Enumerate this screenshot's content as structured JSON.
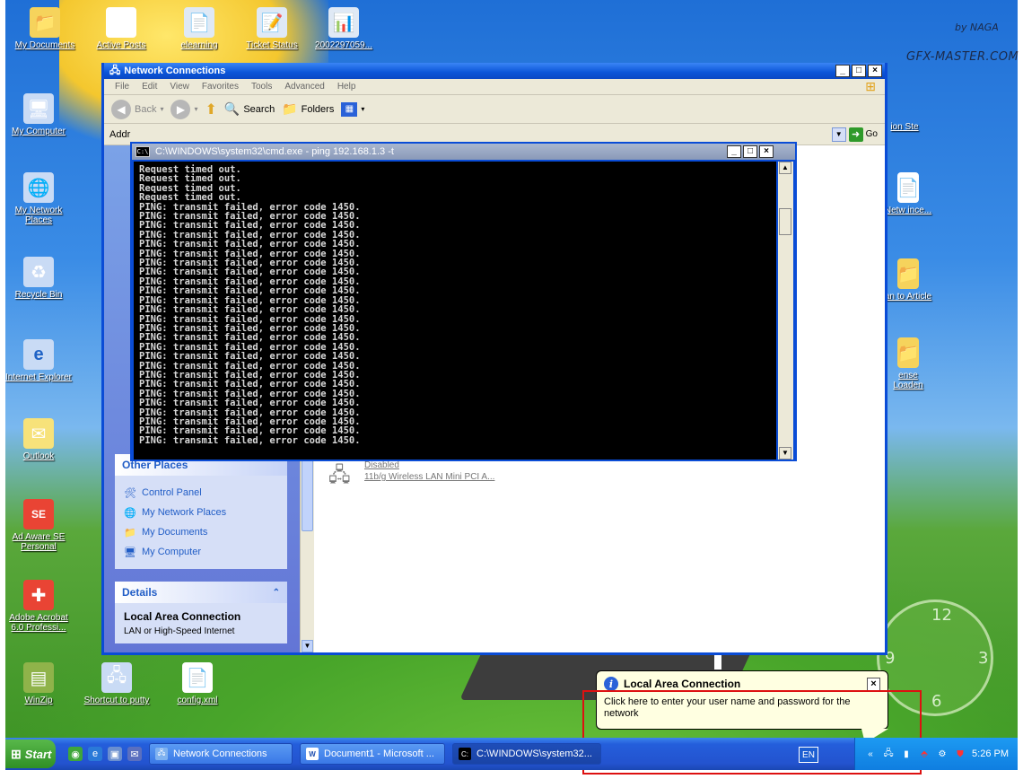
{
  "watermark": {
    "line1": "by NAGA",
    "line2": "GFX-MASTER.COM"
  },
  "desktop_icons": [
    {
      "label": "My Documents",
      "glyph": "📁",
      "color": "#f6d35c"
    },
    {
      "label": "Active Posts",
      "glyph": "🗺",
      "color": "#ffffff"
    },
    {
      "label": "elearning",
      "glyph": "📄",
      "color": "#dfe9f5"
    },
    {
      "label": "Ticket Status",
      "glyph": "📝",
      "color": "#dfe9f5"
    },
    {
      "label": "2002297059...",
      "glyph": "📊",
      "color": "#dfe9f5"
    },
    {
      "label": "My Computer",
      "glyph": "🖥",
      "color": "#c9dbf5"
    },
    {
      "label": "My Network Places",
      "glyph": "🌐",
      "color": "#c9dbf5"
    },
    {
      "label": "Recycle Bin",
      "glyph": "♻",
      "color": "#c9dbf5"
    },
    {
      "label": "Internet Explorer",
      "glyph": "e",
      "color": "#c9dbf5"
    },
    {
      "label": "Outlook",
      "glyph": "✉",
      "color": "#f7e27a"
    },
    {
      "label": "Ad Aware SE Personal",
      "glyph": "SE",
      "color": "#e94434"
    },
    {
      "label": "Adobe Acrobat 6.0 Professi...",
      "glyph": "✚",
      "color": "#e94434"
    },
    {
      "label": "WinZip",
      "glyph": "▤",
      "color": "#8fb34a"
    },
    {
      "label": "Shortcut to putty",
      "glyph": "🖧",
      "color": "#c9dbf5"
    },
    {
      "label": "config.xml",
      "glyph": "📄",
      "color": "#ffffff"
    },
    {
      "label": "ion Ste",
      "glyph": "",
      "color": "#ffffff"
    },
    {
      "label": "Netw ince...",
      "glyph": "📄",
      "color": "#ffffff"
    },
    {
      "label": "an to Article",
      "glyph": "📁",
      "color": "#f6d35c"
    },
    {
      "label": "ense Loaden",
      "glyph": "📁",
      "color": "#f6d35c"
    }
  ],
  "explorer": {
    "title": "Network Connections",
    "menu": [
      "File",
      "Edit",
      "View",
      "Favorites",
      "Tools",
      "Advanced",
      "Help"
    ],
    "toolbar": {
      "back": "Back",
      "search": "Search",
      "folders": "Folders"
    },
    "address_label": "Addr",
    "go_label": "Go",
    "taskpane": {
      "other_places_title": "Other Places",
      "other_places": [
        "Control Panel",
        "My Network Places",
        "My Documents",
        "My Computer"
      ],
      "details_title": "Details",
      "details_name": "Local Area Connection",
      "details_sub": "LAN or High-Speed Internet"
    },
    "connection": {
      "status": "Disabled",
      "device": "11b/g Wireless LAN Mini PCI A..."
    }
  },
  "cmd": {
    "title": "C:\\WINDOWS\\system32\\cmd.exe - ping 192.168.1.3 -t",
    "lines": [
      "Request timed out.",
      "Request timed out.",
      "Request timed out.",
      "Request timed out.",
      "PING: transmit failed, error code 1450.",
      "PING: transmit failed, error code 1450.",
      "PING: transmit failed, error code 1450.",
      "PING: transmit failed, error code 1450.",
      "PING: transmit failed, error code 1450.",
      "PING: transmit failed, error code 1450.",
      "PING: transmit failed, error code 1450.",
      "PING: transmit failed, error code 1450.",
      "PING: transmit failed, error code 1450.",
      "PING: transmit failed, error code 1450.",
      "PING: transmit failed, error code 1450.",
      "PING: transmit failed, error code 1450.",
      "PING: transmit failed, error code 1450.",
      "PING: transmit failed, error code 1450.",
      "PING: transmit failed, error code 1450.",
      "PING: transmit failed, error code 1450.",
      "PING: transmit failed, error code 1450.",
      "PING: transmit failed, error code 1450.",
      "PING: transmit failed, error code 1450.",
      "PING: transmit failed, error code 1450.",
      "PING: transmit failed, error code 1450.",
      "PING: transmit failed, error code 1450.",
      "PING: transmit failed, error code 1450.",
      "PING: transmit failed, error code 1450.",
      "PING: transmit failed, error code 1450.",
      "PING: transmit failed, error code 1450."
    ]
  },
  "clock": {
    "n12": "12",
    "n3": "3",
    "n6": "6",
    "n9": "9"
  },
  "balloon": {
    "title": "Local Area Connection",
    "message": "Click here to enter your user name and password for the network"
  },
  "taskbar": {
    "start": "Start",
    "tasks": [
      "Network Connections",
      "Document1 - Microsoft ...",
      "C:\\WINDOWS\\system32..."
    ],
    "lang": "EN",
    "time": "5:26 PM"
  }
}
